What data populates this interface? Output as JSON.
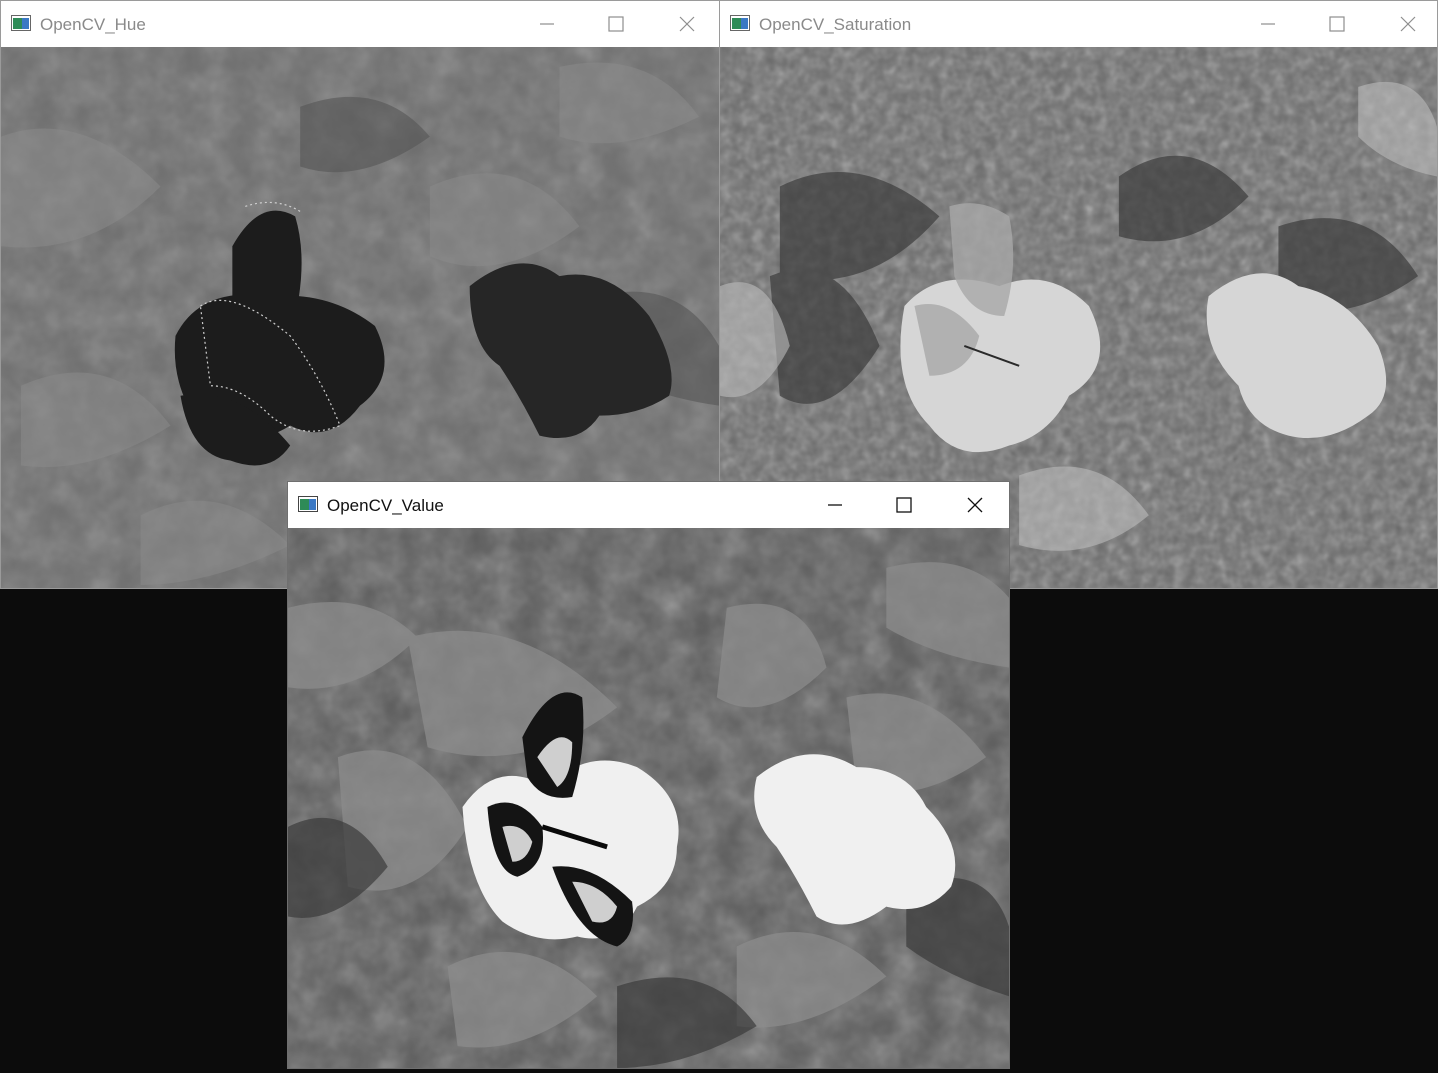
{
  "windows": {
    "hue": {
      "title": "OpenCV_Hue",
      "state": "inactive"
    },
    "saturation": {
      "title": "OpenCV_Saturation",
      "state": "inactive"
    },
    "value": {
      "title": "OpenCV_Value",
      "state": "active"
    }
  },
  "controls": {
    "minimize": "minimize-icon",
    "maximize": "maximize-icon",
    "close": "close-icon"
  },
  "colors": {
    "desktop": "#0c0c0c",
    "titlebar": "#ffffff",
    "icon_green": "#2e8b57",
    "icon_blue": "#3a78c4"
  }
}
